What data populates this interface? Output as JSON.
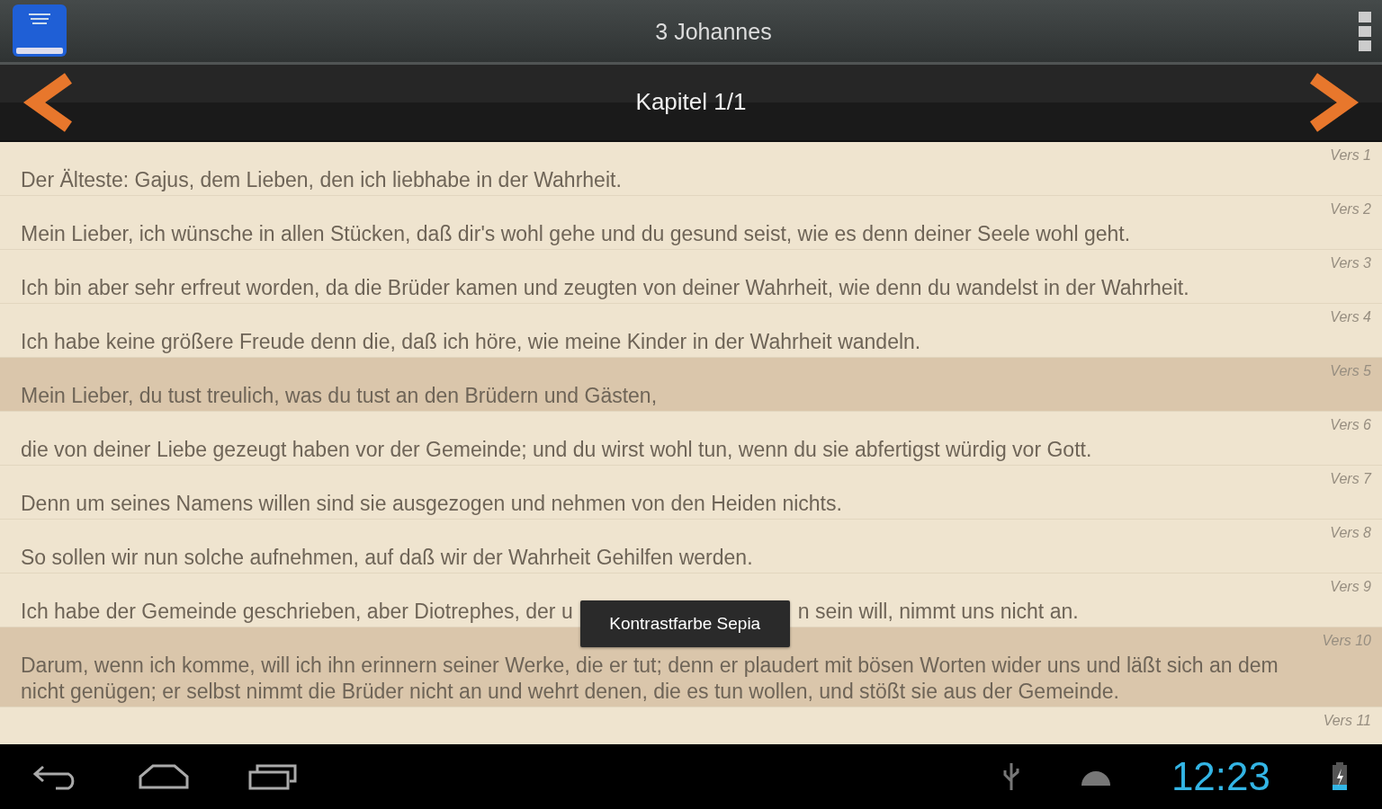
{
  "action_bar": {
    "title": "3 Johannes"
  },
  "chapter_bar": {
    "title": "Kapitel 1/1"
  },
  "verses": [
    {
      "label": "Vers 1",
      "text": "Der Älteste: Gajus, dem Lieben, den ich liebhabe in der Wahrheit.",
      "selected": false
    },
    {
      "label": "Vers 2",
      "text": "Mein Lieber, ich wünsche in allen Stücken, daß dir's wohl gehe und du gesund seist, wie es denn deiner Seele wohl geht.",
      "selected": false
    },
    {
      "label": "Vers 3",
      "text": "Ich bin aber sehr erfreut worden, da die Brüder kamen und zeugten von deiner Wahrheit, wie denn du wandelst in der Wahrheit.",
      "selected": false
    },
    {
      "label": "Vers 4",
      "text": "Ich habe keine größere Freude denn die, daß ich höre, wie meine Kinder in der Wahrheit wandeln.",
      "selected": false
    },
    {
      "label": "Vers 5",
      "text": "Mein Lieber, du tust treulich, was du tust an den Brüdern und Gästen,",
      "selected": true
    },
    {
      "label": "Vers 6",
      "text": "die von deiner Liebe gezeugt haben vor der Gemeinde; und du wirst wohl tun, wenn du sie abfertigst würdig vor Gott.",
      "selected": false
    },
    {
      "label": "Vers 7",
      "text": "Denn um seines Namens willen sind sie ausgezogen und nehmen von den Heiden nichts.",
      "selected": false
    },
    {
      "label": "Vers 8",
      "text": "So sollen wir nun solche aufnehmen, auf daß wir der Wahrheit Gehilfen werden.",
      "selected": false
    },
    {
      "label": "Vers 9",
      "text_parts": [
        "Ich habe der Gemeinde geschrieben, aber Diotrephes, der u",
        "n sein will, nimmt uns nicht an."
      ],
      "selected": false
    },
    {
      "label": "Vers 10",
      "text": "Darum, wenn ich komme, will ich ihn erinnern seiner Werke, die er tut; denn er plaudert mit bösen Worten wider uns und läßt sich an dem nicht genügen; er selbst nimmt die Brüder nicht an und wehrt denen, die es tun wollen, und stößt sie aus der Gemeinde.",
      "selected": true
    },
    {
      "label": "Vers 11",
      "selected": false
    }
  ],
  "toast": {
    "text": "Kontrastfarbe Sepia"
  },
  "status_bar": {
    "time": "12:23"
  }
}
